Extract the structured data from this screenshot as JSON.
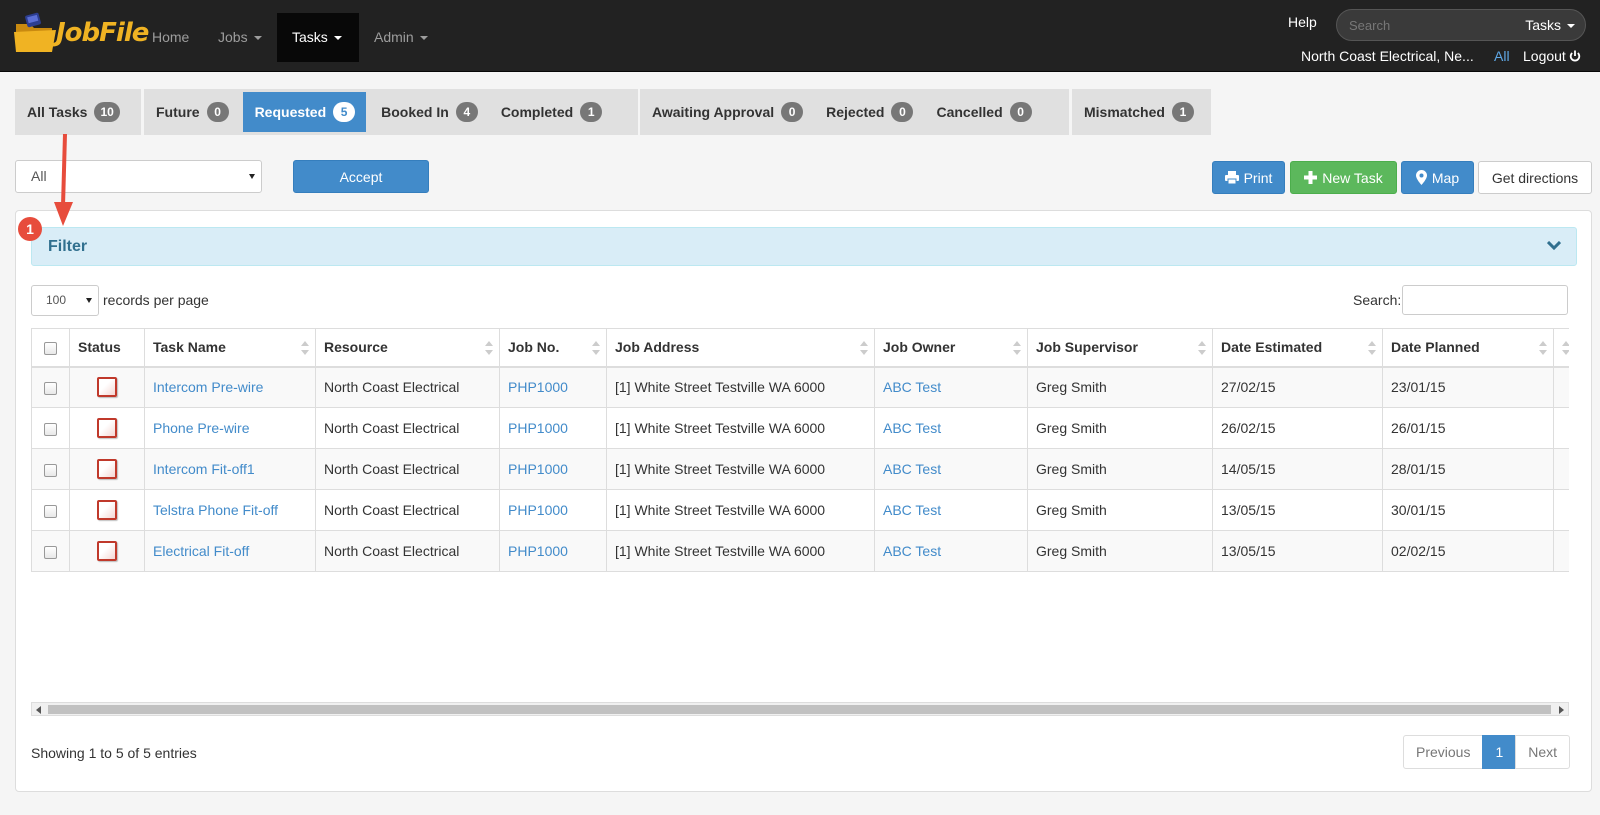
{
  "app": {
    "logo_text": "JobFile"
  },
  "nav": {
    "items": [
      {
        "label": "Home"
      },
      {
        "label": "Jobs"
      },
      {
        "label": "Tasks"
      },
      {
        "label": "Admin"
      }
    ],
    "help": "Help",
    "search_placeholder": "Search",
    "search_scope": "Tasks",
    "company": "North Coast Electrical, Ne...",
    "all_link": "All",
    "logout": "Logout"
  },
  "tabs": [
    {
      "label": "All Tasks",
      "count": "10"
    },
    {
      "label": "Future",
      "count": "0"
    },
    {
      "label": "Requested",
      "count": "5"
    },
    {
      "label": "Booked In",
      "count": "4"
    },
    {
      "label": "Completed",
      "count": "1"
    },
    {
      "label": "Awaiting Approval",
      "count": "0"
    },
    {
      "label": "Rejected",
      "count": "0"
    },
    {
      "label": "Cancelled",
      "count": "0"
    },
    {
      "label": "Mismatched",
      "count": "1"
    }
  ],
  "toolbar": {
    "filter_select": "All",
    "accept": "Accept",
    "print": "Print",
    "new_task": "New Task",
    "map": "Map",
    "directions": "Get directions"
  },
  "filter": {
    "title": "Filter",
    "annotation": "1"
  },
  "table_controls": {
    "per_page": "100",
    "per_page_label": "records per page",
    "search_label": "Search:"
  },
  "table": {
    "columns": [
      "Status",
      "Task Name",
      "Resource",
      "Job No.",
      "Job Address",
      "Job Owner",
      "Job Supervisor",
      "Date Estimated",
      "Date Planned"
    ],
    "rows": [
      {
        "task": "Intercom Pre-wire",
        "resource": "North Coast Electrical",
        "job_no": "PHP1000",
        "address": "[1] White Street Testville WA 6000",
        "owner": "ABC Test",
        "supervisor": "Greg Smith",
        "estimated": "27/02/15",
        "planned": "23/01/15"
      },
      {
        "task": "Phone Pre-wire",
        "resource": "North Coast Electrical",
        "job_no": "PHP1000",
        "address": "[1] White Street Testville WA 6000",
        "owner": "ABC Test",
        "supervisor": "Greg Smith",
        "estimated": "26/02/15",
        "planned": "26/01/15"
      },
      {
        "task": "Intercom Fit-off1",
        "resource": "North Coast Electrical",
        "job_no": "PHP1000",
        "address": "[1] White Street Testville WA 6000",
        "owner": "ABC Test",
        "supervisor": "Greg Smith",
        "estimated": "14/05/15",
        "planned": "28/01/15"
      },
      {
        "task": "Telstra Phone Fit-off",
        "resource": "North Coast Electrical",
        "job_no": "PHP1000",
        "address": "[1] White Street Testville WA 6000",
        "owner": "ABC Test",
        "supervisor": "Greg Smith",
        "estimated": "13/05/15",
        "planned": "30/01/15"
      },
      {
        "task": "Electrical Fit-off",
        "resource": "North Coast Electrical",
        "job_no": "PHP1000",
        "address": "[1] White Street Testville WA 6000",
        "owner": "ABC Test",
        "supervisor": "Greg Smith",
        "estimated": "13/05/15",
        "planned": "02/02/15"
      }
    ]
  },
  "footer": {
    "info": "Showing 1 to 5 of 5 entries",
    "prev": "Previous",
    "page": "1",
    "next": "Next"
  },
  "colors": {
    "primary": "#428bca",
    "success": "#5cb85c",
    "navbar": "#222222",
    "annotation": "#e74c3c",
    "filter_bg": "#d9edf7"
  }
}
